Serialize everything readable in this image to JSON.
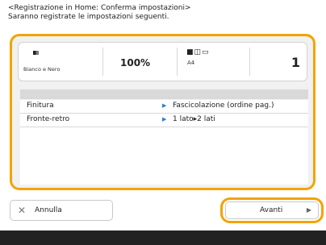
{
  "header": {
    "title": "<Registrazione in Home: Conferma impostazioni>",
    "subtitle": "Saranno registrate le impostazioni seguenti."
  },
  "summary": {
    "color_mode": "Bianco e Nero",
    "zoom": "100%",
    "paper_icons": "■◫▭",
    "paper_size": "A4",
    "copies": "1"
  },
  "settings": [
    {
      "label": "Finitura",
      "value": "Fascicolazione (ordine pag.)"
    },
    {
      "label": "Fronte-retro",
      "value": "1 lato▸2 lati"
    }
  ],
  "buttons": {
    "cancel_label": "Annulla",
    "next_label": "Avanti"
  },
  "colors": {
    "highlight": "#f3a300",
    "accent": "#2a7fd0"
  }
}
